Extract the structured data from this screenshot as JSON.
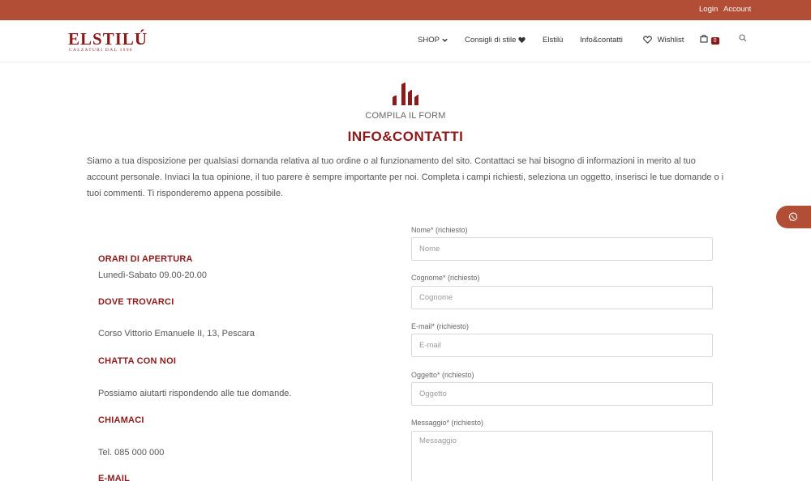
{
  "topbar": {
    "login": "Login",
    "account": "Account"
  },
  "logo": {
    "name": "ELSTILÚ",
    "tagline": "CALZATURI DAL 1990"
  },
  "nav": {
    "shop": "SHOP",
    "consigli": "Consigli di stile",
    "elstilu": "Elstilù",
    "info": "Info&contatti",
    "wishlist": "Wishlist",
    "cart_count": "0"
  },
  "hero": {
    "subheading": "COMPILA IL FORM",
    "title": "INFO&CONTATTI"
  },
  "intro": "Siamo a tua disposizione per qualsiasi domanda relativa al tuo ordine o al funzionamento del sito. Contattaci se hai bisogno di informazioni in merito al tuo account personale. Inviaci la tua opinione, il tuo parere è sempre importante per noi. Completa i campi richiesti, seleziona un oggetto, inserisci le tue domande o i tuoi commenti. Ti risponderemo appena possibile.",
  "info": {
    "hours_title": "ORARI DI APERTURA",
    "hours_text": "Lunedì-Sabato 09.00-20.00",
    "where_title": "DOVE TROVARCI",
    "where_text": "Corso Vittorio Emanuele II, 13, Pescara",
    "chat_title": "CHATTA CON NOI",
    "chat_text": "Possiamo aiutarti rispondendo alle tue domande.",
    "call_title": "CHIAMACI",
    "call_text": "Tel. 085 000 000",
    "email_title": "E-MAIL"
  },
  "form": {
    "nome_label": "Nome* (richiesto)",
    "nome_placeholder": "Nome",
    "cognome_label": "Cognome* (richiesto)",
    "cognome_placeholder": "Cognome",
    "email_label": "E-mail* (richiesto)",
    "email_placeholder": "E-mail",
    "oggetto_label": "Oggetto* (richiesto)",
    "oggetto_placeholder": "Oggetto",
    "messaggio_label": "Messaggio* (richiesto)",
    "messaggio_placeholder": "Messaggio"
  },
  "colors": {
    "brand": "#8b1a1a",
    "topbar": "#b34e36"
  },
  "icons": {
    "shop_chevron": "chevron-down-icon",
    "consigli": "heart-icon",
    "wishlist": "heart-outline-icon",
    "cart": "shopping-bag-icon",
    "search": "search-icon",
    "whatsapp": "whatsapp-icon",
    "hero": "boots-logo-icon"
  }
}
